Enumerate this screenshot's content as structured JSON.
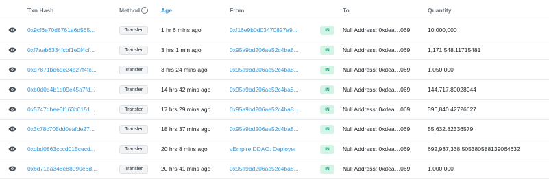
{
  "columns": {
    "txn_hash": "Txn Hash",
    "method": "Method",
    "age": "Age",
    "from": "From",
    "to": "To",
    "quantity": "Quantity"
  },
  "icons": {
    "row_action": "eye-icon",
    "method_info": "info-icon"
  },
  "colors": {
    "link": "#3498db",
    "in_badge_bg": "#d4f5e5",
    "in_badge_text": "#00a186"
  },
  "rows": [
    {
      "hash": "0x9cf6e70d8761a6d565...",
      "method": "Transfer",
      "age": "1 hr 6 mins ago",
      "from": "0xf16e9b0d03470827a9...",
      "direction": "IN",
      "to": "Null Address: 0xdea…069",
      "quantity": "10,000,000"
    },
    {
      "hash": "0xf7aab6334fcbf1e0f4cf...",
      "method": "Transfer",
      "age": "3 hrs 1 min ago",
      "from": "0x95a9bd206ae52c4ba8...",
      "direction": "IN",
      "to": "Null Address: 0xdea…069",
      "quantity": "1,171,548.11715481"
    },
    {
      "hash": "0xd7871bd6de24b27f4fc...",
      "method": "Transfer",
      "age": "3 hrs 24 mins ago",
      "from": "0x95a9bd206ae52c4ba8...",
      "direction": "IN",
      "to": "Null Address: 0xdea…069",
      "quantity": "1,050,000"
    },
    {
      "hash": "0xb0d0d4b1d09e45a7fd...",
      "method": "Transfer",
      "age": "14 hrs 42 mins ago",
      "from": "0x95a9bd206ae52c4ba8...",
      "direction": "IN",
      "to": "Null Address: 0xdea…069",
      "quantity": "144,717.80028944"
    },
    {
      "hash": "0x5747dbee6f163b0151...",
      "method": "Transfer",
      "age": "17 hrs 29 mins ago",
      "from": "0x95a9bd206ae52c4ba8...",
      "direction": "IN",
      "to": "Null Address: 0xdea…069",
      "quantity": "396,840.42726627"
    },
    {
      "hash": "0x3c78c705dd0eafde27...",
      "method": "Transfer",
      "age": "18 hrs 37 mins ago",
      "from": "0x95a9bd206ae52c4ba8...",
      "direction": "IN",
      "to": "Null Address: 0xdea…069",
      "quantity": "55,632.82336579"
    },
    {
      "hash": "0xdbd0863cccd015cecd...",
      "method": "Transfer",
      "age": "20 hrs 8 mins ago",
      "from": "vEmpire DDAO: Deployer",
      "direction": "IN",
      "to": "Null Address: 0xdea…069",
      "quantity": "692,937,338.505380588139064632"
    },
    {
      "hash": "0x6d71ba346e88090e6d...",
      "method": "Transfer",
      "age": "20 hrs 41 mins ago",
      "from": "0x95a9bd206ae52c4ba8...",
      "direction": "IN",
      "to": "Null Address: 0xdea…069",
      "quantity": "1,000,000"
    }
  ]
}
